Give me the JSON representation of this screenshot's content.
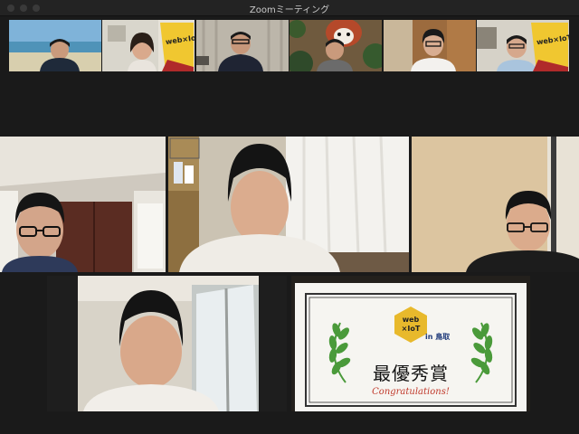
{
  "window": {
    "title": "Zoomミーティング"
  },
  "thumbnails": [
    {
      "id": "p1",
      "bg": "beach"
    },
    {
      "id": "p2",
      "bg": "web-iot-banner",
      "logo_text": "web×IoT"
    },
    {
      "id": "p3",
      "bg": "wall"
    },
    {
      "id": "p4",
      "bg": "red-panda"
    },
    {
      "id": "p5",
      "bg": "wood-room"
    },
    {
      "id": "p6",
      "bg": "web-iot-banner",
      "logo_text": "web×IoT"
    }
  ],
  "certificate": {
    "logo_line1": "web",
    "logo_line2": "×IoT",
    "location": "in 鳥取",
    "award": "最優秀賞",
    "congrats": "Congratulations!"
  },
  "colors": {
    "titlebar": "#232323",
    "background": "#1a1a1a",
    "logo_yellow": "#e8b92c",
    "laurel_green": "#4a9a3a",
    "congrats_red": "#c0392b"
  }
}
